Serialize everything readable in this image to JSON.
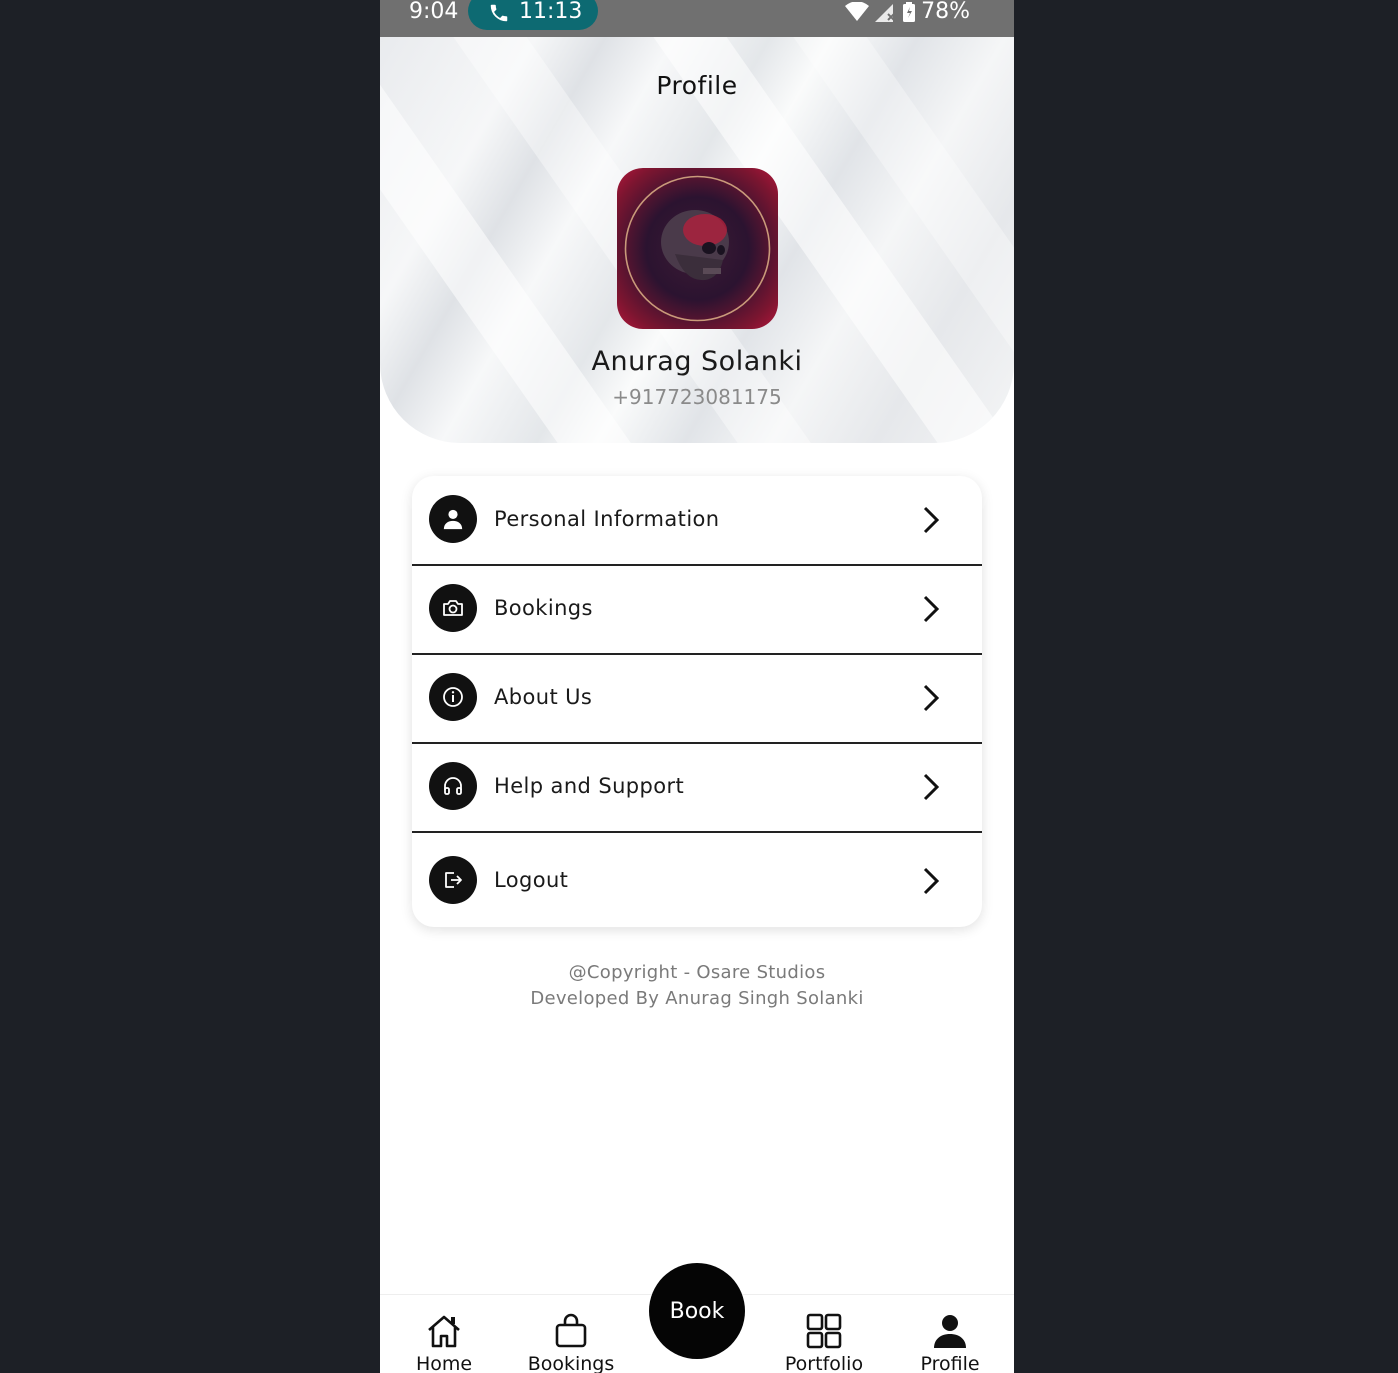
{
  "status_bar": {
    "time": "9:04",
    "call_time": "11:13",
    "battery": "78%",
    "call_pill_color": "#0d6a72"
  },
  "header": {
    "title": "Profile",
    "user_name": "Anurag Solanki",
    "user_phone": "+917723081175"
  },
  "menu": {
    "items": [
      {
        "label": "Personal Information",
        "icon": "user-icon"
      },
      {
        "label": "Bookings",
        "icon": "camera-icon"
      },
      {
        "label": "About Us",
        "icon": "info-icon"
      },
      {
        "label": "Help and Support",
        "icon": "headphones-icon"
      },
      {
        "label": "Logout",
        "icon": "logout-icon"
      }
    ]
  },
  "footer": {
    "copyright": "@Copyright - Osare Studios",
    "developer": "Developed By Anurag Singh Solanki"
  },
  "bottom_nav": {
    "items": [
      {
        "label": "Home",
        "icon": "home-icon"
      },
      {
        "label": "Bookings",
        "icon": "bag-icon"
      },
      {
        "label": "Portfolio",
        "icon": "grid-icon"
      },
      {
        "label": "Profile",
        "icon": "person-icon",
        "active": true
      }
    ],
    "book_label": "Book"
  }
}
